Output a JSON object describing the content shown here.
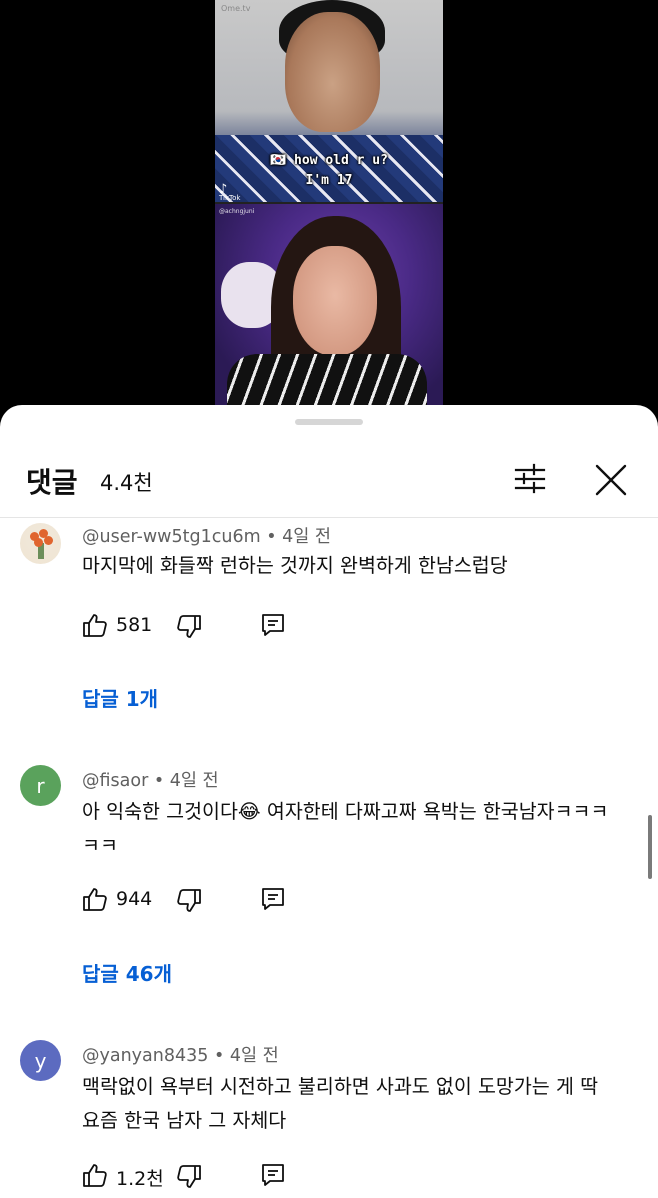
{
  "video": {
    "watermark": "Ome.tv",
    "caption_line1": "🇰🇷 how old r u?",
    "caption_line2": "I'm 17",
    "tiktok_label": "TikTok",
    "tiktok_handle": "@achngjuni"
  },
  "sheet": {
    "title": "댓글",
    "count": "4.4천"
  },
  "comments": [
    {
      "author": "@user-ww5tg1cu6m",
      "time": "4일 전",
      "text": "마지막에 화들짝 런하는 것까지 완벽하게 한남스럽당",
      "likes": "581",
      "replies": "답글 1개",
      "avatar_letter": ""
    },
    {
      "author": "@fisaor",
      "time": "4일 전",
      "text": "아 익숙한 그것이다😂 여자한테 다짜고짜 욕박는 한국남자ㅋㅋㅋㅋㅋ",
      "likes": "944",
      "replies": "답글 46개",
      "avatar_letter": "r"
    },
    {
      "author": "@yanyan8435",
      "time": "4일 전",
      "text": "맥락없이 욕부터 시전하고 불리하면 사과도 없이 도망가는 게 딱 요즘 한국 남자 그 자체다",
      "likes": "1.2천",
      "avatar_letter": "y"
    }
  ],
  "separator": " • ",
  "colors": {
    "link": "#065fd4",
    "meta": "#606060",
    "avatar_r": "#5aa25c",
    "avatar_y": "#5c6bc0"
  }
}
